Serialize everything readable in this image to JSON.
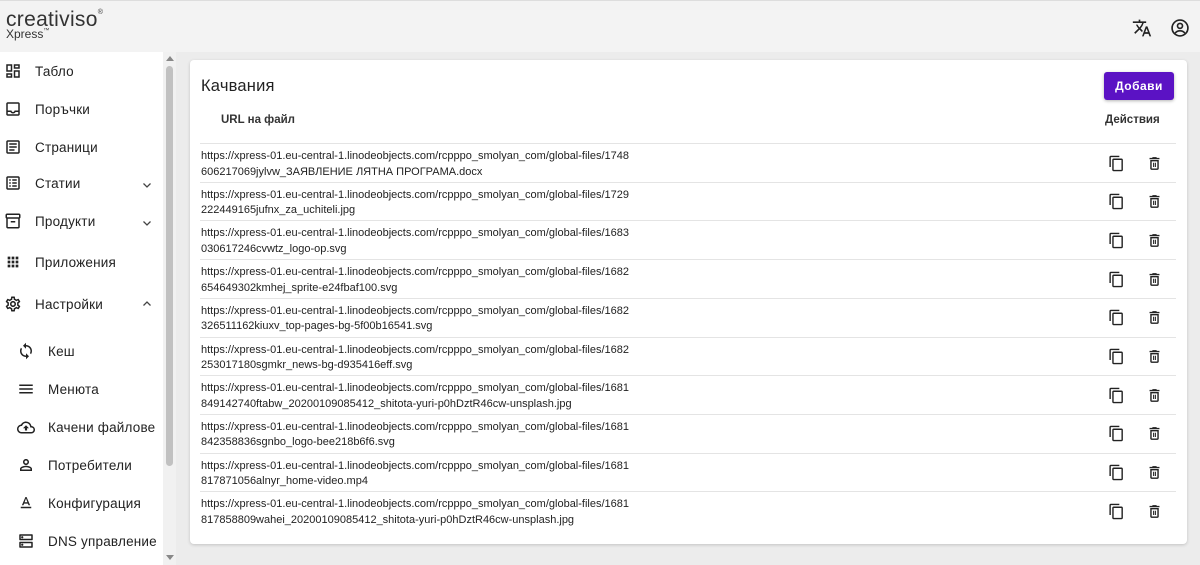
{
  "app": {
    "logo_text": "creativiso",
    "logo_mark": "®",
    "logo_sub": "Xpress",
    "logo_sub_mark": "™"
  },
  "header": {
    "language_icon": "translate-icon",
    "account_icon": "account-circle-icon"
  },
  "sidebar": {
    "items": [
      {
        "label": "Табло",
        "icon": "dashboard-icon"
      },
      {
        "label": "Поръчки",
        "icon": "inbox-icon"
      },
      {
        "label": "Страници",
        "icon": "article-icon"
      },
      {
        "label": "Статии",
        "icon": "list-icon",
        "expandable": true,
        "expanded": false
      },
      {
        "label": "Продукти",
        "icon": "archive-icon",
        "expandable": true,
        "expanded": false
      },
      {
        "label": "Приложения",
        "icon": "apps-icon"
      },
      {
        "label": "Настройки",
        "icon": "settings-icon",
        "expandable": true,
        "expanded": true
      }
    ],
    "subitems": [
      {
        "label": "Кеш",
        "icon": "sync-icon"
      },
      {
        "label": "Менюта",
        "icon": "menu-icon"
      },
      {
        "label": "Качени файлове",
        "icon": "cloud-upload-icon"
      },
      {
        "label": "Потребители",
        "icon": "person-icon"
      },
      {
        "label": "Конфигурация",
        "icon": "text-format-icon"
      },
      {
        "label": "DNS управление",
        "icon": "dns-icon"
      }
    ]
  },
  "main": {
    "title": "Качвания",
    "add_button": "Добави",
    "columns": {
      "url": "URL на файл",
      "actions": "Действия"
    },
    "rows": [
      {
        "url": "https://xpress-01.eu-central-1.linodeobjects.com/rcpppo_smolyan_com/global-files/1748606217069jylvw_ЗАЯВЛЕНИЕ ЛЯТНА ПРОГРАМА.docx"
      },
      {
        "url": "https://xpress-01.eu-central-1.linodeobjects.com/rcpppo_smolyan_com/global-files/1729222449165jufnx_za_uchiteli.jpg"
      },
      {
        "url": "https://xpress-01.eu-central-1.linodeobjects.com/rcpppo_smolyan_com/global-files/1683030617246cvwtz_logo-op.svg"
      },
      {
        "url": "https://xpress-01.eu-central-1.linodeobjects.com/rcpppo_smolyan_com/global-files/1682654649302kmhej_sprite-e24fbaf100.svg"
      },
      {
        "url": "https://xpress-01.eu-central-1.linodeobjects.com/rcpppo_smolyan_com/global-files/1682326511162kiuxv_top-pages-bg-5f00b16541.svg"
      },
      {
        "url": "https://xpress-01.eu-central-1.linodeobjects.com/rcpppo_smolyan_com/global-files/1682253017180sgmkr_news-bg-d935416eff.svg"
      },
      {
        "url": "https://xpress-01.eu-central-1.linodeobjects.com/rcpppo_smolyan_com/global-files/1681849142740ftabw_20200109085412_shitota-yuri-p0hDztR46cw-unsplash.jpg"
      },
      {
        "url": "https://xpress-01.eu-central-1.linodeobjects.com/rcpppo_smolyan_com/global-files/1681842358836sgnbo_logo-bee218b6f6.svg"
      },
      {
        "url": "https://xpress-01.eu-central-1.linodeobjects.com/rcpppo_smolyan_com/global-files/1681817871056alnyr_home-video.mp4"
      },
      {
        "url": "https://xpress-01.eu-central-1.linodeobjects.com/rcpppo_smolyan_com/global-files/1681817858809wahei_20200109085412_shitota-yuri-p0hDztR46cw-unsplash.jpg"
      }
    ],
    "row_actions": [
      "copy-icon",
      "delete-icon"
    ]
  },
  "colors": {
    "accent": "#5b12c4",
    "background": "#ececec",
    "card": "#ffffff"
  }
}
